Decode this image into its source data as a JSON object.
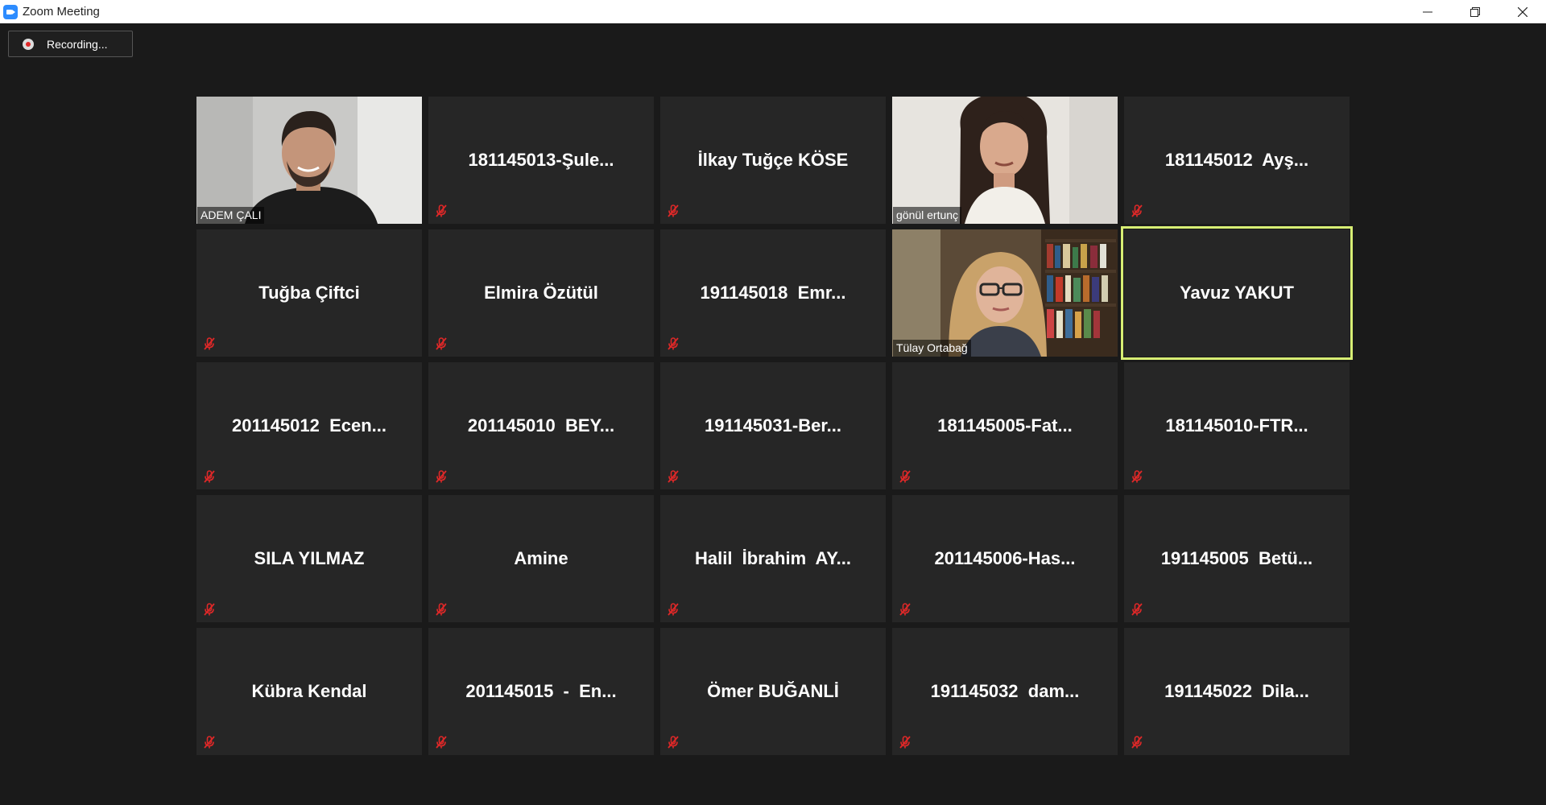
{
  "window": {
    "title": "Zoom Meeting"
  },
  "recording": {
    "label": "Recording..."
  },
  "colors": {
    "active_speaker": "#d7ee74",
    "mute_icon": "#e02828",
    "tile_bg": "#262626"
  },
  "participants": [
    {
      "name": "ADEM ÇALI",
      "video": true
    },
    {
      "name": "181145013-Şule...",
      "video": false,
      "muted": true
    },
    {
      "name": "İlkay Tuğçe KÖSE",
      "video": false,
      "muted": true
    },
    {
      "name": "gönül ertunç",
      "video": true
    },
    {
      "name": "181145012  Ayş...",
      "video": false,
      "muted": true
    },
    {
      "name": "Tuğba Çiftci",
      "video": false,
      "muted": true
    },
    {
      "name": "Elmira Özütül",
      "video": false,
      "muted": true
    },
    {
      "name": "191145018  Emr...",
      "video": false,
      "muted": true
    },
    {
      "name": "Tülay Ortabağ",
      "video": true
    },
    {
      "name": "Yavuz YAKUT",
      "video": false,
      "muted": false,
      "active": true
    },
    {
      "name": "201145012  Ecen...",
      "video": false,
      "muted": true
    },
    {
      "name": "201145010  BEY...",
      "video": false,
      "muted": true
    },
    {
      "name": "191145031-Ber...",
      "video": false,
      "muted": true
    },
    {
      "name": "181145005-Fat...",
      "video": false,
      "muted": true
    },
    {
      "name": "181145010-FTR...",
      "video": false,
      "muted": true
    },
    {
      "name": "SILA YILMAZ",
      "video": false,
      "muted": true
    },
    {
      "name": "Amine",
      "video": false,
      "muted": true
    },
    {
      "name": "Halil  İbrahim  AY...",
      "video": false,
      "muted": true
    },
    {
      "name": "201145006-Has...",
      "video": false,
      "muted": true
    },
    {
      "name": "191145005  Betü...",
      "video": false,
      "muted": true
    },
    {
      "name": "Kübra Kendal",
      "video": false,
      "muted": true
    },
    {
      "name": "201145015  -  En...",
      "video": false,
      "muted": true
    },
    {
      "name": "Ömer BUĞANLİ",
      "video": false,
      "muted": true
    },
    {
      "name": "191145032  dam...",
      "video": false,
      "muted": true
    },
    {
      "name": "191145022  Dila...",
      "video": false,
      "muted": true
    }
  ]
}
